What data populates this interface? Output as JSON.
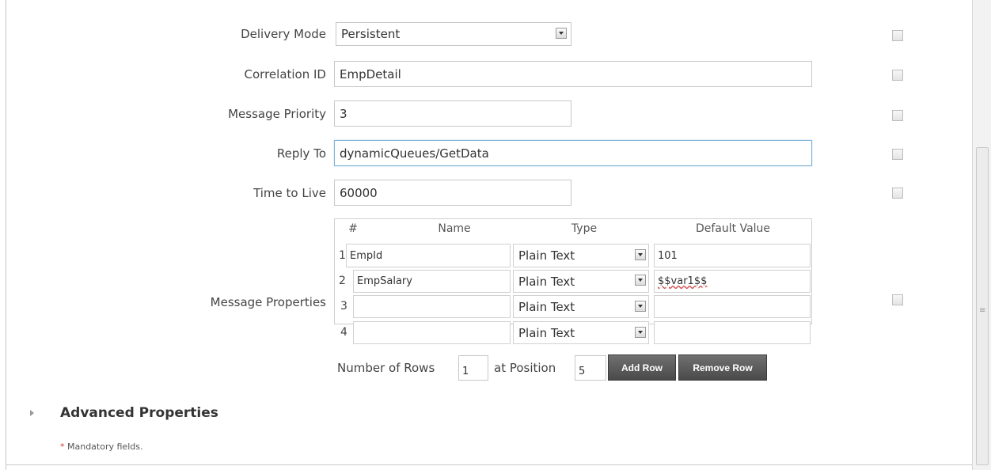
{
  "form": {
    "delivery_mode": {
      "label": "Delivery Mode",
      "value": "Persistent"
    },
    "correlation_id": {
      "label": "Correlation ID",
      "value": "EmpDetail"
    },
    "message_priority": {
      "label": "Message Priority",
      "value": "3"
    },
    "reply_to": {
      "label": "Reply To",
      "value": "dynamicQueues/GetData"
    },
    "time_to_live": {
      "label": "Time to Live",
      "value": "60000"
    },
    "message_properties": {
      "label": "Message Properties",
      "columns": [
        "#",
        "Name",
        "Type",
        "Default Value"
      ],
      "rows": [
        {
          "num": "1",
          "name": "EmpId",
          "type": "Plain Text",
          "default": "101"
        },
        {
          "num": "2",
          "name": "EmpSalary",
          "type": "Plain Text",
          "default": "$$var1$$"
        },
        {
          "num": "3",
          "name": "",
          "type": "Plain Text",
          "default": ""
        },
        {
          "num": "4",
          "name": "",
          "type": "Plain Text",
          "default": ""
        }
      ],
      "number_of_rows_label": "Number of Rows",
      "number_of_rows_value": "1",
      "at_position_label": "at Position",
      "at_position_value": "5",
      "add_row_label": "Add Row",
      "remove_row_label": "Remove Row"
    }
  },
  "advanced": {
    "title": "Advanced Properties"
  },
  "footer": {
    "mandatory_star": "*",
    "mandatory_text": "Mandatory fields."
  }
}
